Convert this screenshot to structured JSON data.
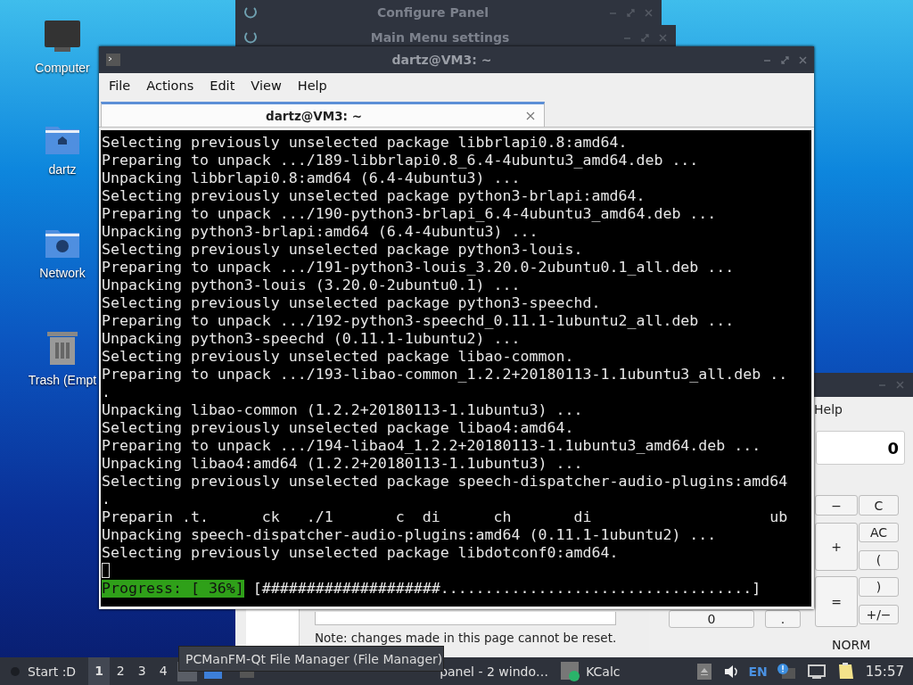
{
  "desktop_icons": [
    {
      "label": "Computer",
      "kind": "computer"
    },
    {
      "label": "dartz",
      "kind": "home"
    },
    {
      "label": "Network",
      "kind": "network"
    },
    {
      "label": "Trash (Empt",
      "kind": "trash"
    }
  ],
  "configure_panel": {
    "title": "Configure Panel"
  },
  "main_menu_settings": {
    "title": "Main Menu settings",
    "note": "Note: changes made in this page cannot be reset."
  },
  "terminal": {
    "title": "dartz@VM3: ~",
    "menu": [
      "File",
      "Actions",
      "Edit",
      "View",
      "Help"
    ],
    "tab": {
      "title": "dartz@VM3: ~",
      "selected": true
    },
    "lines": [
      "Selecting previously unselected package libbrlapi0.8:amd64.",
      "Preparing to unpack .../189-libbrlapi0.8_6.4-4ubuntu3_amd64.deb ...",
      "Unpacking libbrlapi0.8:amd64 (6.4-4ubuntu3) ...",
      "Selecting previously unselected package python3-brlapi:amd64.",
      "Preparing to unpack .../190-python3-brlapi_6.4-4ubuntu3_amd64.deb ...",
      "Unpacking python3-brlapi:amd64 (6.4-4ubuntu3) ...",
      "Selecting previously unselected package python3-louis.",
      "Preparing to unpack .../191-python3-louis_3.20.0-2ubuntu0.1_all.deb ...",
      "Unpacking python3-louis (3.20.0-2ubuntu0.1) ...",
      "Selecting previously unselected package python3-speechd.",
      "Preparing to unpack .../192-python3-speechd_0.11.1-1ubuntu2_all.deb ...",
      "Unpacking python3-speechd (0.11.1-1ubuntu2) ...",
      "Selecting previously unselected package libao-common.",
      "Preparing to unpack .../193-libao-common_1.2.2+20180113-1.1ubuntu3_all.deb ..",
      ".",
      "Unpacking libao-common (1.2.2+20180113-1.1ubuntu3) ...",
      "Selecting previously unselected package libao4:amd64.",
      "Preparing to unpack .../194-libao4_1.2.2+20180113-1.1ubuntu3_amd64.deb ...",
      "Unpacking libao4:amd64 (1.2.2+20180113-1.1ubuntu3) ...",
      "Selecting previously unselected package speech-dispatcher-audio-plugins:amd64",
      ".",
      "Preparin .t.      ck   ./1       c  di      ch       di                    ub",
      "Unpacking speech-dispatcher-audio-plugins:amd64 (0.11.1-1ubuntu2) ...",
      "Selecting previously unselected package libdotconf0:amd64."
    ],
    "progress_label": "Progress: [ 36%]",
    "progress_bar": "[####################...................................]"
  },
  "kcalc": {
    "menu_item": "Help",
    "display": "0",
    "buttons": [
      "−",
      "C",
      "+",
      "AC",
      "(",
      ")",
      "=",
      "0",
      ".",
      "+/−"
    ],
    "mode": "NORM"
  },
  "taskbar": {
    "start": "Start :D",
    "workspaces": [
      {
        "label": "1",
        "selected": true
      },
      {
        "label": "2",
        "selected": false
      },
      {
        "label": "3",
        "selected": false
      },
      {
        "label": "4",
        "selected": false
      }
    ],
    "tasks": [
      {
        "kind": "file-manager"
      },
      {
        "kind": "folder"
      },
      {
        "kind": "terminal"
      },
      {
        "kind": "panel",
        "label": "panel - 2 windo…"
      },
      {
        "kind": "calculator",
        "label": "KCalc"
      }
    ],
    "tooltip": "PCManFM-Qt File Manager (File Manager)",
    "language": "EN",
    "clock": "15:57"
  }
}
